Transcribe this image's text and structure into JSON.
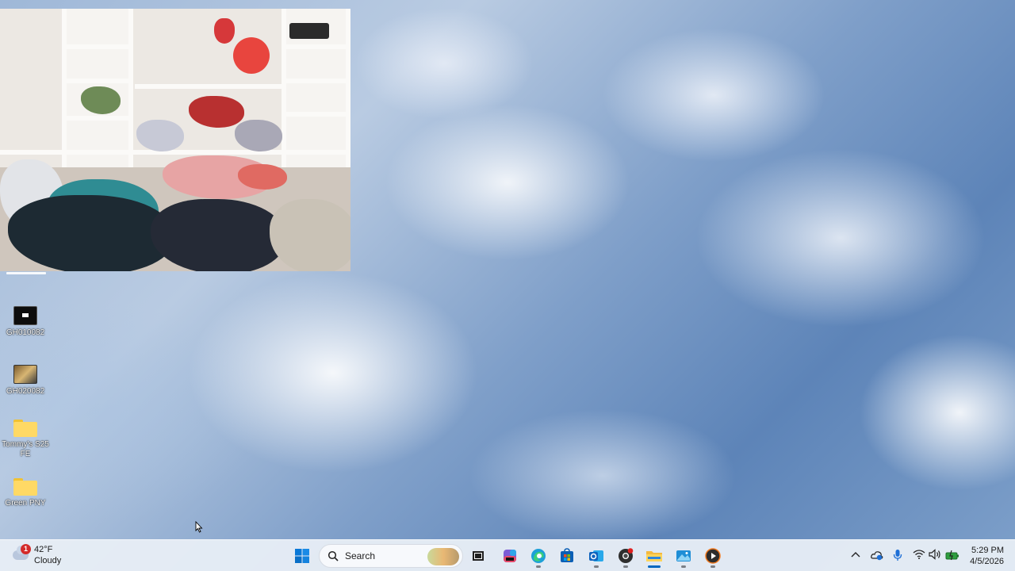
{
  "desktop": {
    "icons": [
      {
        "label": "GH010082",
        "kind": "video"
      },
      {
        "label": "GH020082",
        "kind": "video"
      },
      {
        "label": "Tommy's S25 FE",
        "kind": "folder"
      },
      {
        "label": "Green PNY",
        "kind": "folder"
      }
    ]
  },
  "taskbar": {
    "weather": {
      "badge": "1",
      "temperature": "42°F",
      "condition": "Cloudy"
    },
    "search": {
      "label": "Search"
    },
    "apps": [
      {
        "name": "start-button"
      },
      {
        "name": "task-view"
      },
      {
        "name": "copilot"
      },
      {
        "name": "edge"
      },
      {
        "name": "microsoft-store"
      },
      {
        "name": "outlook"
      },
      {
        "name": "chrome"
      },
      {
        "name": "file-explorer"
      },
      {
        "name": "photos"
      },
      {
        "name": "media-player"
      }
    ],
    "clock": {
      "time": "5:29 PM",
      "date": "4/5/2026"
    }
  }
}
